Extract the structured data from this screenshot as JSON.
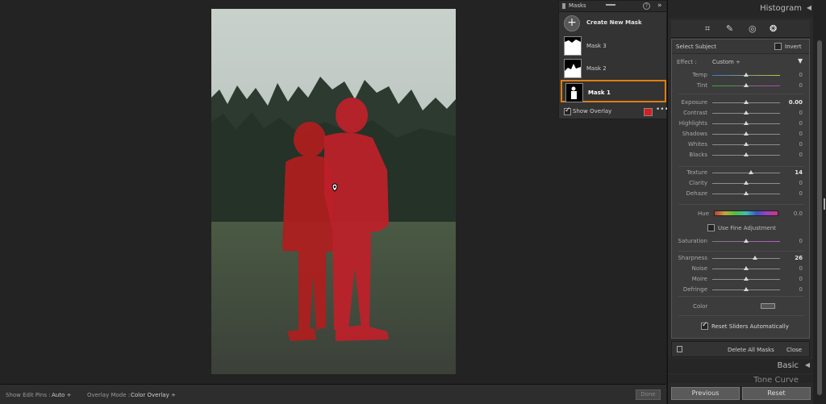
{
  "masks_panel": {
    "title": "Masks",
    "help": "?",
    "collapse": "»",
    "create_icon": "+",
    "create_label": "Create New Mask",
    "items": [
      {
        "label": "Mask 3"
      },
      {
        "label": "Mask 2"
      },
      {
        "label": "Mask 1",
        "selected": true
      }
    ],
    "show_overlay": {
      "label": "Show Overlay",
      "checked": true
    },
    "overlay_color": "#d81e1e",
    "more": "•••"
  },
  "right_panel": {
    "histogram_title": "Histogram",
    "subject": {
      "name": "Select Subject",
      "invert_label": "Invert"
    },
    "effect": {
      "label": "Effect :",
      "value": "Custom ÷"
    },
    "sliders_a": [
      {
        "label": "Temp",
        "value": "0"
      },
      {
        "label": "Tint",
        "value": "0"
      }
    ],
    "sliders_b": [
      {
        "label": "Exposure",
        "value": "0.00"
      },
      {
        "label": "Contrast",
        "value": "0"
      },
      {
        "label": "Highlights",
        "value": "0"
      },
      {
        "label": "Shadows",
        "value": "0"
      },
      {
        "label": "Whites",
        "value": "0"
      },
      {
        "label": "Blacks",
        "value": "0"
      }
    ],
    "sliders_c": [
      {
        "label": "Texture",
        "value": "14"
      },
      {
        "label": "Clarity",
        "value": "0"
      },
      {
        "label": "Dehaze",
        "value": "0"
      }
    ],
    "hue": {
      "label": "Hue",
      "value": "0.0"
    },
    "fine_adjust_label": "Use Fine Adjustment",
    "saturation": {
      "label": "Saturation",
      "value": "0"
    },
    "sliders_d": [
      {
        "label": "Sharpness",
        "value": "26"
      },
      {
        "label": "Noise",
        "value": "0"
      },
      {
        "label": "Moire",
        "value": "0"
      },
      {
        "label": "Defringe",
        "value": "0"
      }
    ],
    "color_label": "Color",
    "reset_sliders_label": "Reset Sliders Automatically",
    "delete_all_label": "Delete All Masks",
    "close_label": "Close",
    "basic_title": "Basic",
    "tone_curve_title": "Tone Curve",
    "previous_label": "Previous",
    "reset_label": "Reset"
  },
  "toolbar": {
    "show_pins_label": "Show Edit Pins :",
    "show_pins_value": "Auto ÷",
    "overlay_mode_label": "Overlay Mode :",
    "overlay_mode_value": "Color Overlay ÷",
    "done_label": "Done"
  },
  "icons": [
    "crop-icon",
    "heal-icon",
    "redeye-icon",
    "mask-icon",
    "pin-icon"
  ]
}
